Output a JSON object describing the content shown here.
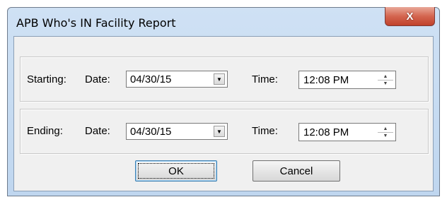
{
  "window": {
    "title": "APB Who's IN Facility Report",
    "close_glyph": "X"
  },
  "starting": {
    "label": "Starting:",
    "date_label": "Date:",
    "date_value": "04/30/15",
    "time_label": "Time:",
    "time_value": "12:08 PM"
  },
  "ending": {
    "label": "Ending:",
    "date_label": "Date:",
    "date_value": "04/30/15",
    "time_label": "Time:",
    "time_value": "12:08 PM"
  },
  "buttons": {
    "ok": "OK",
    "cancel": "Cancel"
  }
}
